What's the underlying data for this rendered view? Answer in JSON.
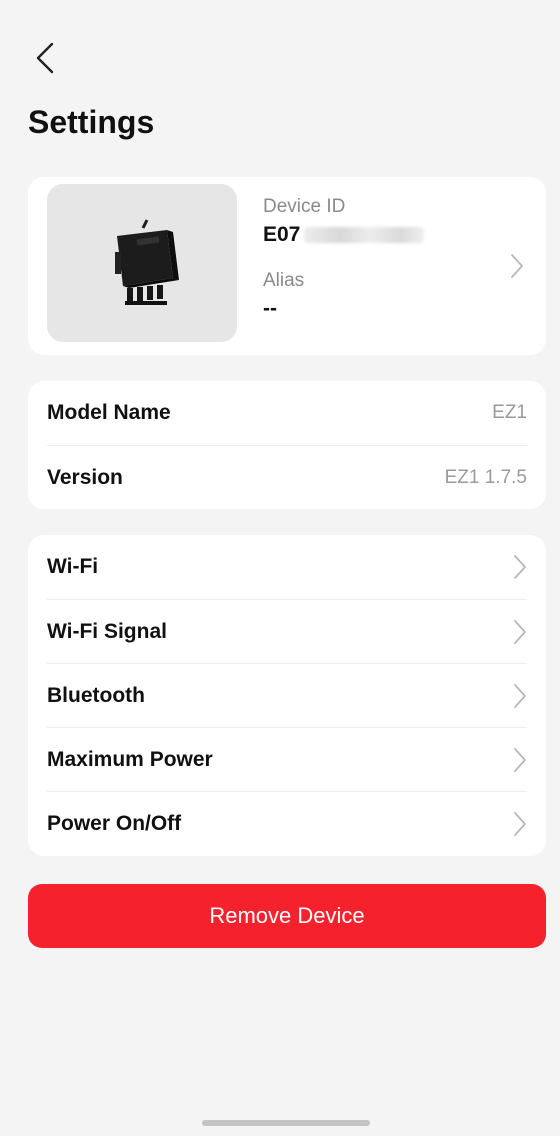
{
  "header": {
    "back_icon": "chevron-left-icon",
    "title": "Settings"
  },
  "device": {
    "image": "microinverter-device",
    "id_label": "Device ID",
    "id_value": "E07",
    "alias_label": "Alias",
    "alias_value": "--",
    "chevron_icon": "chevron-right-icon"
  },
  "info": {
    "rows": [
      {
        "label": "Model Name",
        "value": "EZ1"
      },
      {
        "label": "Version",
        "value": "EZ1 1.7.5"
      }
    ]
  },
  "menu": {
    "items": [
      {
        "label": "Wi-Fi"
      },
      {
        "label": "Wi-Fi Signal"
      },
      {
        "label": "Bluetooth"
      },
      {
        "label": "Maximum Power"
      },
      {
        "label": "Power On/Off"
      }
    ]
  },
  "actions": {
    "remove_label": "Remove Device"
  },
  "colors": {
    "background": "#f4f4f4",
    "card": "#ffffff",
    "danger": "#f5222d",
    "muted_text": "#8a8a8a",
    "chevron": "#b8b8b8"
  }
}
